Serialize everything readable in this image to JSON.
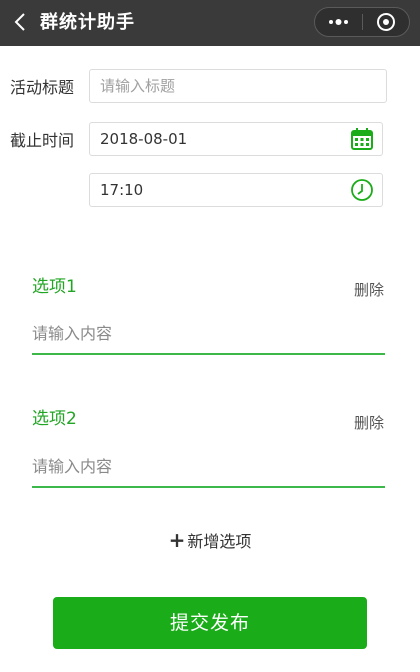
{
  "header": {
    "title": "群统计助手"
  },
  "form": {
    "activity_title_label": "活动标题",
    "activity_title_placeholder": "请输入标题",
    "deadline_label": "截止时间",
    "deadline_date": "2018-08-01",
    "deadline_time": "17:10"
  },
  "options": [
    {
      "title": "选项1",
      "delete_label": "删除",
      "placeholder": "请输入内容"
    },
    {
      "title": "选项2",
      "delete_label": "删除",
      "placeholder": "请输入内容"
    }
  ],
  "add_option_label": "新增选项",
  "submit_label": "提交发布",
  "icons": {
    "back": "chevron-left-icon",
    "more": "more-dots-icon",
    "close": "target-circle-icon",
    "date": "calendar-icon",
    "time": "clock-icon"
  },
  "colors": {
    "header_bg": "#3a3a3a",
    "accent_green": "#1aad19",
    "option_green": "#22a524"
  }
}
